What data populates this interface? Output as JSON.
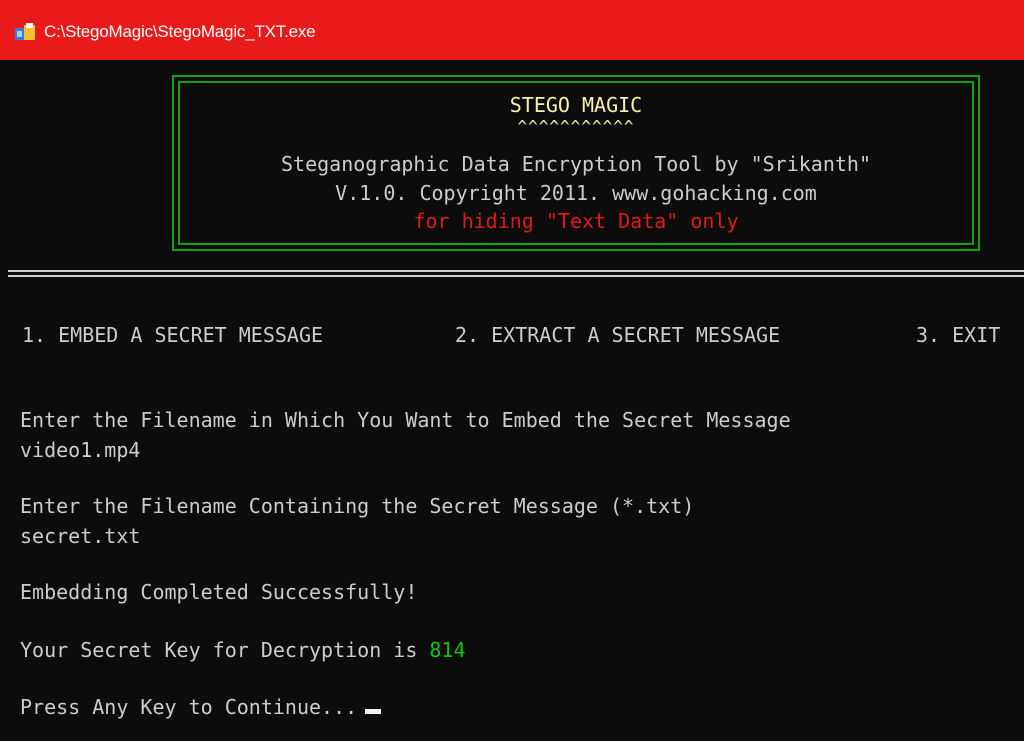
{
  "window": {
    "title": "C:\\StegoMagic\\StegoMagic_TXT.exe",
    "titlebar_color": "#e81a1a",
    "icon": "console-app-icon"
  },
  "banner": {
    "title": "STEGO MAGIC",
    "underline": "^^^^^^^^^^^",
    "subtitle": "Steganographic Data Encryption Tool by \"Srikanth\"",
    "version": "V.1.0. Copyright 2011. www.gohacking.com",
    "note": "for hiding \"Text Data\" only",
    "border_color": "#13a10e"
  },
  "menu": {
    "option1": "1. EMBED A SECRET MESSAGE",
    "option2": "2. EXTRACT A SECRET MESSAGE",
    "option3": "3. EXIT"
  },
  "session": {
    "prompt_target_file": "Enter the Filename in Which You Want to Embed the Secret Message",
    "target_file": "video1.mp4",
    "prompt_message_file": "Enter the Filename Containing the Secret Message (*.txt)",
    "message_file": "secret.txt",
    "status": "Embedding Completed Successfully!",
    "key_label": "Your Secret Key for Decryption is ",
    "key_value": "814",
    "continue_prompt": "Press Any Key to Continue..."
  },
  "colors": {
    "title_yellow": "#f9f1a5",
    "note_red": "#e01a1a",
    "key_green": "#16c60c",
    "text_gray": "#cccccc",
    "background": "#0c0c0c"
  }
}
